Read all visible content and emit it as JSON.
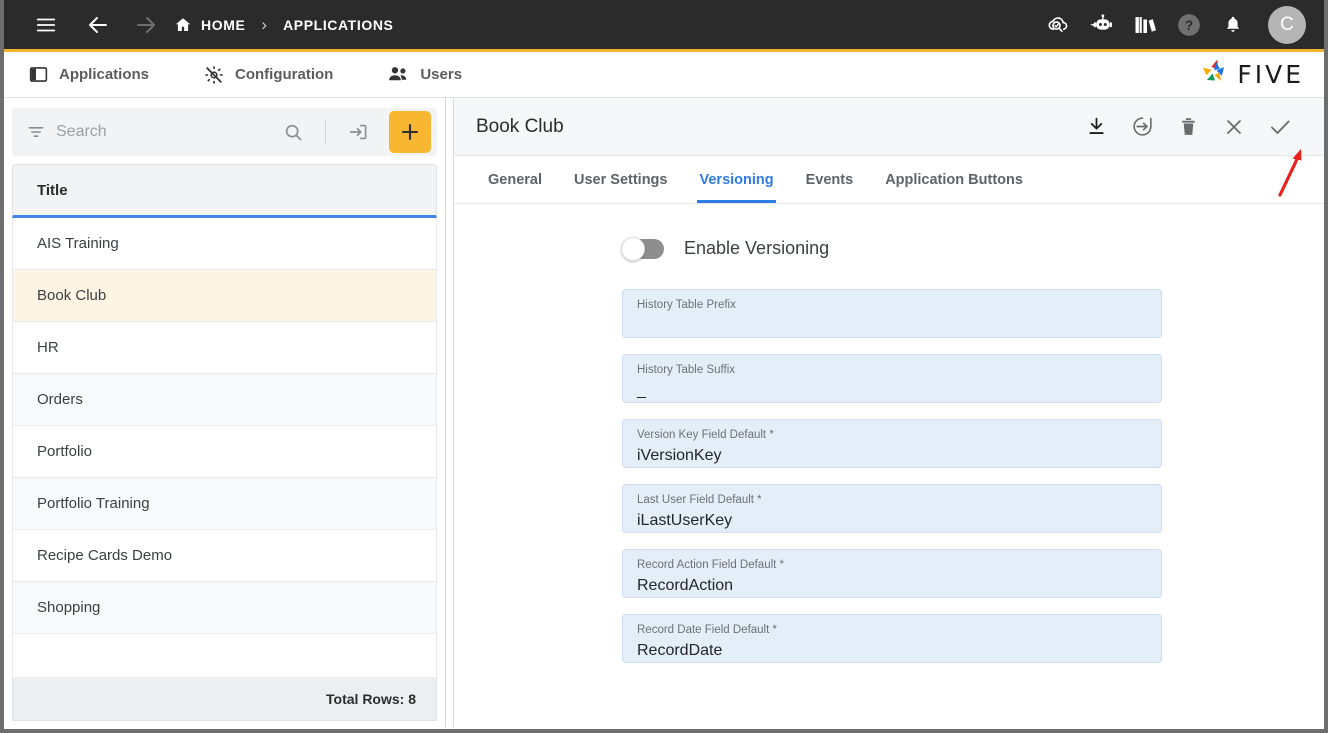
{
  "topbar": {
    "menu_icon": "hamburger-menu-icon",
    "back_icon": "back-arrow-icon",
    "forward_icon": "forward-arrow-icon",
    "home_icon": "home-icon",
    "home_label": "HOME",
    "separator": "›",
    "current_label": "APPLICATIONS",
    "right_icons": [
      {
        "name": "cloud-search-icon"
      },
      {
        "name": "robot-assistant-icon"
      },
      {
        "name": "books-library-icon"
      },
      {
        "name": "help-icon"
      },
      {
        "name": "notifications-bell-icon"
      }
    ],
    "avatar_initial": "C"
  },
  "navbar": {
    "tabs": [
      {
        "label": "Applications",
        "icon": "panel-layout-icon"
      },
      {
        "label": "Configuration",
        "icon": "gear-icon"
      },
      {
        "label": "Users",
        "icon": "users-icon"
      }
    ],
    "logo_text": "FIVE"
  },
  "sidebar": {
    "search": {
      "placeholder": "Search",
      "value": "",
      "filter_icon": "filter-icon",
      "search_icon": "search-icon",
      "import_icon": "import-arrow-icon",
      "add_icon": "plus-icon"
    },
    "column_header": "Title",
    "rows": [
      {
        "title": "AIS Training",
        "selected": false
      },
      {
        "title": "Book Club",
        "selected": true
      },
      {
        "title": "HR",
        "selected": false
      },
      {
        "title": "Orders",
        "selected": false
      },
      {
        "title": "Portfolio",
        "selected": false
      },
      {
        "title": "Portfolio Training",
        "selected": false
      },
      {
        "title": "Recipe Cards Demo",
        "selected": false
      },
      {
        "title": "Shopping",
        "selected": false
      }
    ],
    "footer": "Total Rows: 8"
  },
  "main": {
    "title": "Book Club",
    "actions": [
      {
        "name": "download-icon"
      },
      {
        "name": "export-icon"
      },
      {
        "name": "delete-trash-icon"
      },
      {
        "name": "close-x-icon"
      },
      {
        "name": "save-check-icon"
      }
    ],
    "tabs": [
      {
        "label": "General",
        "active": false
      },
      {
        "label": "User Settings",
        "active": false
      },
      {
        "label": "Versioning",
        "active": true
      },
      {
        "label": "Events",
        "active": false
      },
      {
        "label": "Application Buttons",
        "active": false
      }
    ],
    "toggle": {
      "label": "Enable Versioning",
      "enabled": false
    },
    "fields": [
      {
        "label": "History Table Prefix",
        "value": ""
      },
      {
        "label": "History Table Suffix",
        "value": "_"
      },
      {
        "label": "Version Key Field Default *",
        "value": "iVersionKey"
      },
      {
        "label": "Last User Field Default *",
        "value": "iLastUserKey"
      },
      {
        "label": "Record Action Field Default *",
        "value": "RecordAction"
      },
      {
        "label": "Record Date Field Default *",
        "value": "RecordDate"
      }
    ]
  },
  "annotation": {
    "arrow": "red-pointer-arrow",
    "color": "#e8201e",
    "points_to": "save-check-icon"
  },
  "colors": {
    "topbar_bg": "#2b2b2b",
    "accent_yellow": "#f4b32c",
    "active_blue": "#2f7ce5",
    "selected_row": "#fdf4e3",
    "field_bg": "#e3eef9"
  }
}
